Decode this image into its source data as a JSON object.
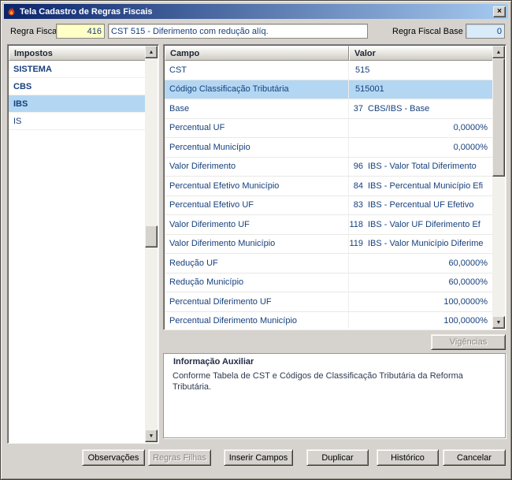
{
  "window": {
    "title": "Tela Cadastro de Regras Fiscais"
  },
  "icons": {
    "close": "×",
    "scroll_up": "▲",
    "scroll_down": "▼"
  },
  "colors": {
    "titlebar_start": "#0a246a",
    "titlebar_end": "#a6caf0",
    "dialog_bg": "#d6d3ce",
    "selection": "#b3d7f3",
    "field_yellow": "#ffffc6",
    "field_blue": "#d9eaf9",
    "text_navy": "#16407c"
  },
  "header": {
    "regra_fiscal_label": "Regra Fiscal",
    "regra_fiscal_value": "416",
    "descricao_value": "CST 515 - Diferimento com redução alíq.",
    "regra_fiscal_base_label": "Regra Fiscal Base",
    "regra_fiscal_base_value": "0"
  },
  "impostos": {
    "header": "Impostos",
    "items": [
      {
        "label": "SISTEMA",
        "bold": true,
        "selected": false
      },
      {
        "label": "CBS",
        "bold": true,
        "selected": false
      },
      {
        "label": "IBS",
        "bold": true,
        "selected": true
      },
      {
        "label": "IS",
        "bold": false,
        "selected": false
      }
    ]
  },
  "grid": {
    "columns": [
      "Campo",
      "Valor"
    ],
    "rows": [
      {
        "campo": "CST",
        "num": "515",
        "desc": "",
        "align": "left",
        "selected": false
      },
      {
        "campo": "Código Classificação Tributária",
        "num": "515001",
        "desc": "",
        "align": "left",
        "selected": true
      },
      {
        "campo": "Base",
        "num": "37",
        "desc": "CBS/IBS - Base",
        "align": "numdesc",
        "selected": false
      },
      {
        "campo": "Percentual UF",
        "num": "0,0000%",
        "desc": "",
        "align": "right",
        "selected": false
      },
      {
        "campo": "Percentual Município",
        "num": "0,0000%",
        "desc": "",
        "align": "right",
        "selected": false
      },
      {
        "campo": "Valor Diferimento",
        "num": "96",
        "desc": "IBS - Valor Total Diferimento",
        "align": "numdesc",
        "selected": false
      },
      {
        "campo": "Percentual Efetivo Município",
        "num": "84",
        "desc": "IBS - Percentual Município Efi",
        "align": "numdesc",
        "selected": false
      },
      {
        "campo": "Percentual Efetivo UF",
        "num": "83",
        "desc": "IBS - Percentual UF Efetivo",
        "align": "numdesc",
        "selected": false
      },
      {
        "campo": "Valor Diferimento UF",
        "num": "118",
        "desc": "IBS - Valor UF Diferimento Ef",
        "align": "numdesc",
        "selected": false
      },
      {
        "campo": "Valor Diferimento Município",
        "num": "119",
        "desc": "IBS - Valor Município Diferime",
        "align": "numdesc",
        "selected": false
      },
      {
        "campo": "Redução UF",
        "num": "60,0000%",
        "desc": "",
        "align": "right",
        "selected": false
      },
      {
        "campo": "Redução Município",
        "num": "60,0000%",
        "desc": "",
        "align": "right",
        "selected": false
      },
      {
        "campo": "Percentual Diferimento UF",
        "num": "100,0000%",
        "desc": "",
        "align": "right",
        "selected": false
      },
      {
        "campo": "Percentual Diferimento Município",
        "num": "100,0000%",
        "desc": "",
        "align": "right",
        "selected": false
      }
    ]
  },
  "aux": {
    "title": "Informação Auxiliar",
    "text": "Conforme Tabela de CST e Códigos de Classificação Tributária da Reforma Tributária."
  },
  "buttons": {
    "vigencias": "Vigências",
    "observacoes": "Observações",
    "regras_filhas": "Regras Filhas",
    "inserir_campos": "Inserir Campos",
    "duplicar": "Duplicar",
    "historico": "Histórico",
    "cancelar": "Cancelar"
  }
}
